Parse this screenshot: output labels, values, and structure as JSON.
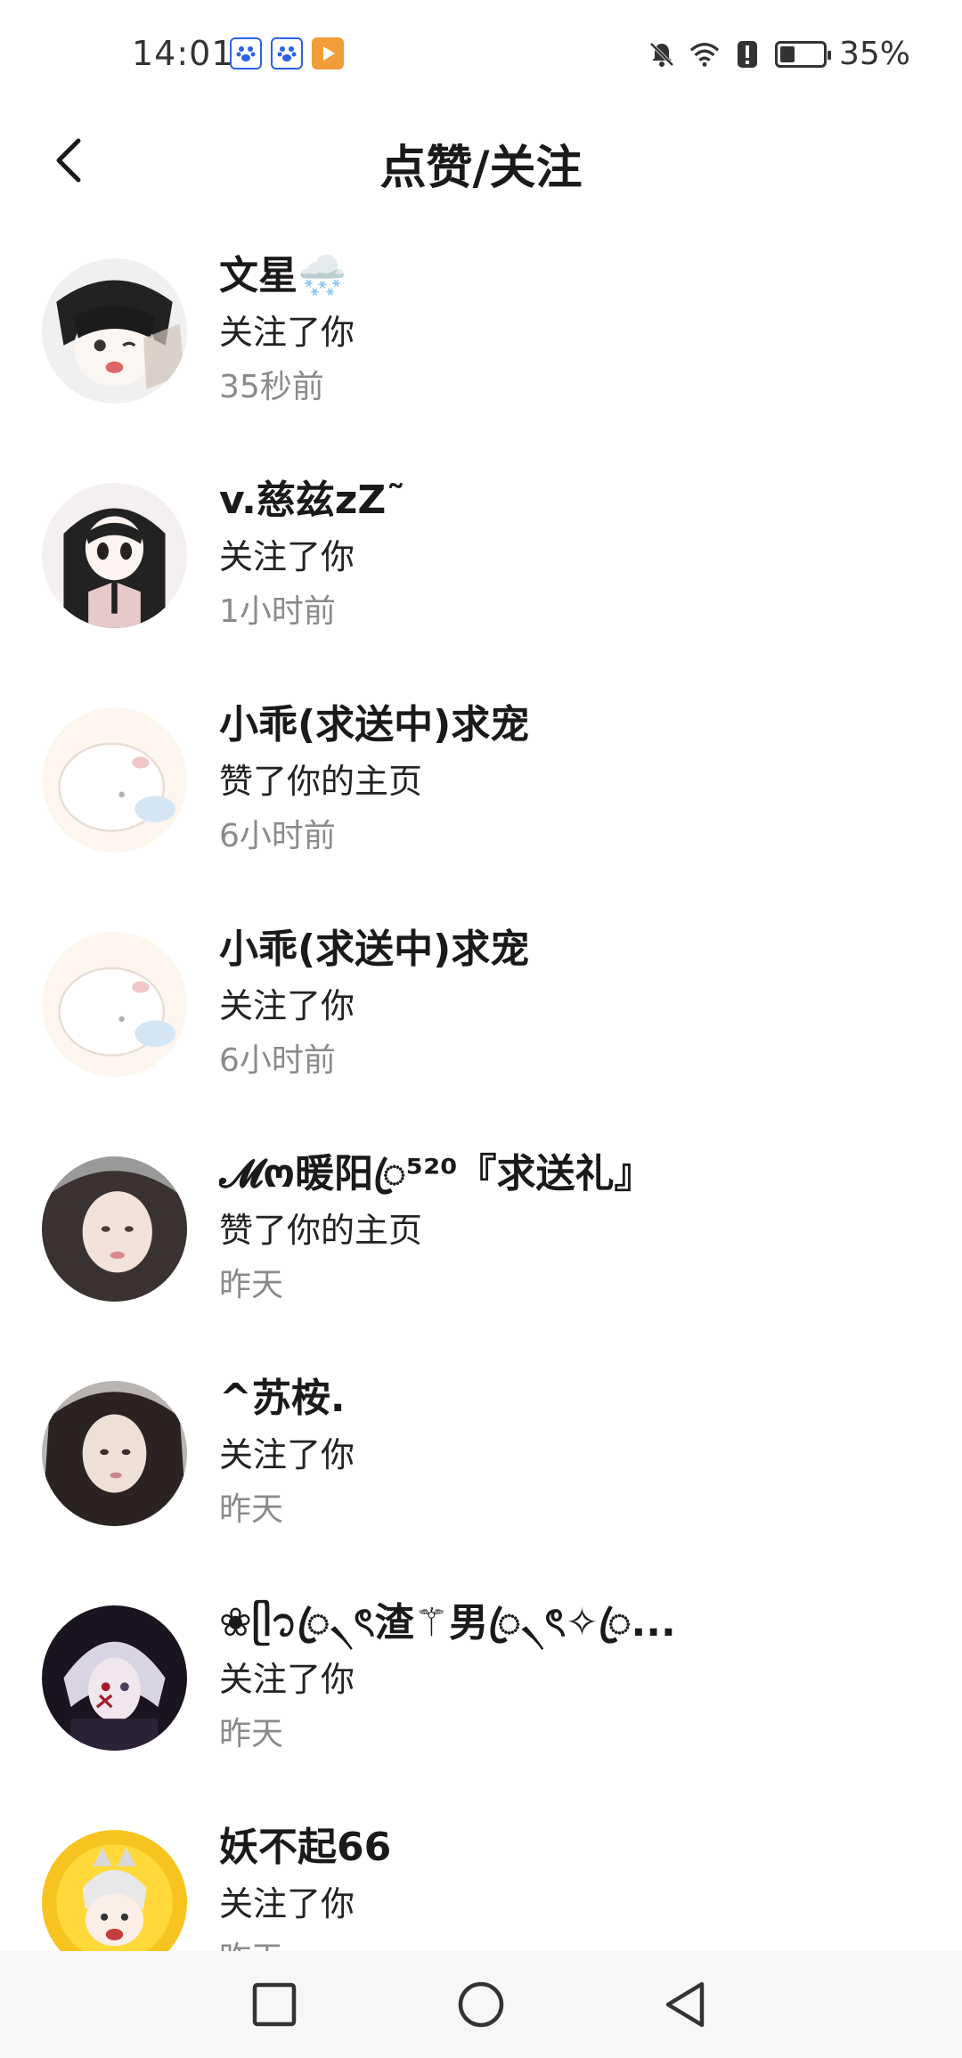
{
  "status_bar": {
    "time": "14:01",
    "battery_percent": "35%",
    "battery_level": 0.35,
    "icons": [
      "baidu-paw-icon",
      "baidu-paw-icon",
      "video-play-icon",
      "mute-bell-icon",
      "wifi-icon",
      "alert-icon",
      "battery-icon"
    ]
  },
  "header": {
    "title": "点赞/关注",
    "back_icon": "chevron-left-icon"
  },
  "items": [
    {
      "name": "文星🌨️",
      "action": "关注了你",
      "time": "35秒前"
    },
    {
      "name": "v.慈兹zZ˜",
      "action": "关注了你",
      "time": "1小时前"
    },
    {
      "name": "小乖(求送中)求宠",
      "action": "赞了你的主页",
      "time": "6小时前"
    },
    {
      "name": "小乖(求送中)求宠",
      "action": "关注了你",
      "time": "6小时前"
    },
    {
      "name": "𝓜ო暖阳ꦿ⁵²⁰『求送礼』",
      "action": "赞了你的主页",
      "time": "昨天"
    },
    {
      "name": "^苏桉.",
      "action": "关注了你",
      "time": "昨天"
    },
    {
      "name": "❀ᥫ᭡ꦿ৲ৎ渣⚚男ꦿ৲ৎ✧ꦿ...",
      "action": "关注了你",
      "time": "昨天"
    },
    {
      "name": "妖不起66",
      "action": "关注了你",
      "time": "昨天"
    }
  ],
  "colors": {
    "text_primary": "#1a1a1a",
    "text_secondary": "#8a8a8a",
    "nav_bar_bg": "#f7f7f7"
  },
  "nav": {
    "icons": [
      "recents-square-icon",
      "home-circle-icon",
      "back-triangle-icon"
    ]
  }
}
